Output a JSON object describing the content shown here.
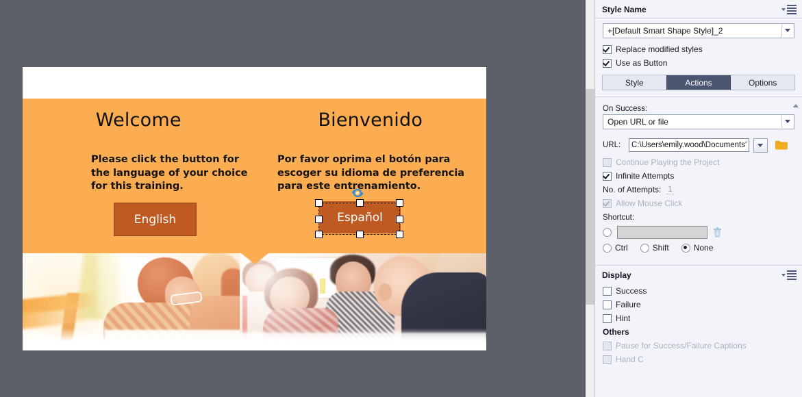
{
  "app": {
    "canvas_bg": "#5c6069",
    "accent_orange": "#fcad52",
    "button_brown": "#bf5b22",
    "active_tab_color": "#4a5570"
  },
  "slide": {
    "left_column": {
      "heading": "Welcome",
      "body": "Please click the button for\nthe language of your choice\nfor this training.",
      "button_label": "English"
    },
    "right_column": {
      "heading": "Bienvenido",
      "body": "Por favor oprima el botón para\nescoger su idioma de preferencia\npara este entrenamiento.",
      "button_label": "Español"
    }
  },
  "selection": {
    "rotate_icon": "rotate-handle-icon"
  },
  "panel": {
    "style_section": {
      "title": "Style Name",
      "menu_icon": "panel-menu-icon",
      "style_value": "+[Default Smart Shape Style]_2",
      "checkboxes": [
        {
          "label": "Replace modified styles",
          "checked": true,
          "disabled": false
        },
        {
          "label": "Use as Button",
          "checked": true,
          "disabled": false
        }
      ]
    },
    "tabs": [
      {
        "label": "Style",
        "active": false
      },
      {
        "label": "Actions",
        "active": true
      },
      {
        "label": "Options",
        "active": false
      }
    ],
    "actions": {
      "on_success_label": "On Success:",
      "on_success_value": "Open URL or file",
      "url_label": "URL:",
      "url_value": "C:\\Users\\emily.wood\\Documents'",
      "browse_icon": "folder-icon",
      "dropdown_icon": "chevron-down-icon",
      "continue_playing": {
        "label": "Continue Playing the Project",
        "checked": false,
        "disabled": true
      },
      "infinite_attempts": {
        "label": "Infinite Attempts",
        "checked": true,
        "disabled": false
      },
      "attempts_label": "No. of Attempts:",
      "attempts_value": "1",
      "allow_mouse_click": {
        "label": "Allow Mouse Click",
        "checked": true,
        "disabled": true
      },
      "shortcut_label": "Shortcut:",
      "shortcut_value": "",
      "delete_icon": "trash-icon",
      "modifiers": [
        {
          "label": "Ctrl",
          "selected": false
        },
        {
          "label": "Shift",
          "selected": false
        },
        {
          "label": "None",
          "selected": true
        }
      ]
    },
    "display_section": {
      "title": "Display",
      "menu_icon": "panel-menu-icon",
      "checkboxes": [
        {
          "label": "Success",
          "checked": false,
          "disabled": false
        },
        {
          "label": "Failure",
          "checked": false,
          "disabled": false
        },
        {
          "label": "Hint",
          "checked": false,
          "disabled": false
        }
      ]
    },
    "others_section": {
      "title": "Others",
      "checkboxes": [
        {
          "label": "Pause for Success/Failure Captions",
          "checked": false,
          "disabled": true
        },
        {
          "label": "Hand C",
          "checked": false,
          "disabled": true
        }
      ]
    }
  }
}
